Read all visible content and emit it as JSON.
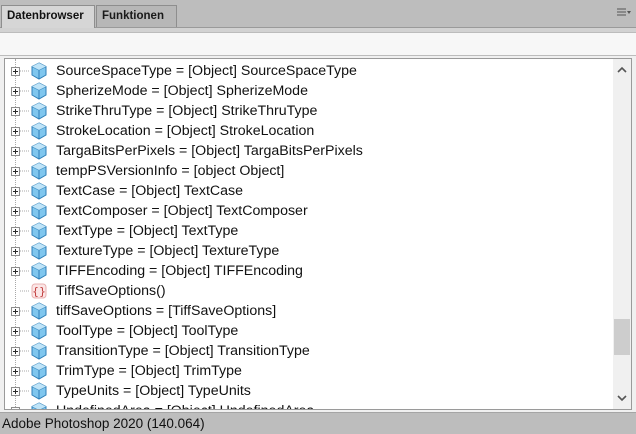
{
  "tabs": [
    {
      "label": "Datenbrowser",
      "active": true
    },
    {
      "label": "Funktionen",
      "active": false
    }
  ],
  "panel_menu_icon": "panel-menu-icon",
  "tree": {
    "rows": [
      {
        "label": "SourceSpaceType = [Object] SourceSpaceType",
        "icon": "object-icon",
        "expandable": true
      },
      {
        "label": "SpherizeMode = [Object] SpherizeMode",
        "icon": "object-icon",
        "expandable": true
      },
      {
        "label": "StrikeThruType = [Object] StrikeThruType",
        "icon": "object-icon",
        "expandable": true
      },
      {
        "label": "StrokeLocation = [Object] StrokeLocation",
        "icon": "object-icon",
        "expandable": true
      },
      {
        "label": "TargaBitsPerPixels = [Object] TargaBitsPerPixels",
        "icon": "object-icon",
        "expandable": true
      },
      {
        "label": "tempPSVersionInfo = [object Object]",
        "icon": "object-icon",
        "expandable": true
      },
      {
        "label": "TextCase = [Object] TextCase",
        "icon": "object-icon",
        "expandable": true
      },
      {
        "label": "TextComposer = [Object] TextComposer",
        "icon": "object-icon",
        "expandable": true
      },
      {
        "label": "TextType = [Object] TextType",
        "icon": "object-icon",
        "expandable": true
      },
      {
        "label": "TextureType = [Object] TextureType",
        "icon": "object-icon",
        "expandable": true
      },
      {
        "label": "TIFFEncoding = [Object] TIFFEncoding",
        "icon": "object-icon",
        "expandable": true
      },
      {
        "label": "TiffSaveOptions()",
        "icon": "function-icon",
        "expandable": false
      },
      {
        "label": "tiffSaveOptions = [TiffSaveOptions]",
        "icon": "object-icon",
        "expandable": true
      },
      {
        "label": "ToolType = [Object] ToolType",
        "icon": "object-icon",
        "expandable": true
      },
      {
        "label": "TransitionType = [Object] TransitionType",
        "icon": "object-icon",
        "expandable": true
      },
      {
        "label": "TrimType = [Object] TrimType",
        "icon": "object-icon",
        "expandable": true
      },
      {
        "label": "TypeUnits = [Object] TypeUnits",
        "icon": "object-icon",
        "expandable": true
      },
      {
        "label": "UndefinedArea = [Object] UndefinedArea",
        "icon": "object-icon",
        "expandable": true
      }
    ]
  },
  "scrollbar": {
    "position": 0.88
  },
  "status": {
    "text": "Adobe Photoshop 2020 (140.064)"
  }
}
